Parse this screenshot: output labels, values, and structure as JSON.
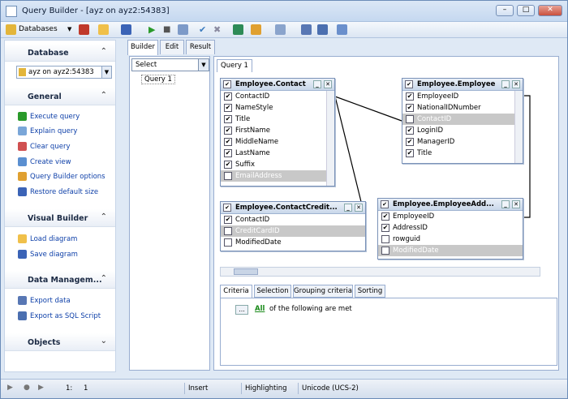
{
  "window": {
    "title": "Query Builder - [ayz on ayz2:54383]",
    "buttons": [
      "minimize",
      "maximize",
      "close"
    ]
  },
  "toolbar": {
    "database_label": "Databases"
  },
  "left": {
    "database": {
      "header": "Database",
      "selected": "ayz on ayz2:54383"
    },
    "general": {
      "header": "General",
      "items": [
        "Execute query",
        "Explain query",
        "Clear query",
        "Create view",
        "Query Builder options",
        "Restore default size"
      ]
    },
    "visual_builder": {
      "header": "Visual Builder",
      "items": [
        "Load diagram",
        "Save diagram"
      ]
    },
    "data_management": {
      "header": "Data Managem...",
      "items": [
        "Export data",
        "Export as SQL Script"
      ]
    },
    "objects": {
      "header": "Objects"
    }
  },
  "tabs": [
    "Builder",
    "Edit",
    "Result"
  ],
  "tree": {
    "select_value": "Select",
    "items": [
      "Query 1"
    ]
  },
  "query_tab": "Query 1",
  "tables": {
    "contact": {
      "title": "Employee.Contact",
      "fields": [
        "ContactID",
        "NameStyle",
        "Title",
        "FirstName",
        "MiddleName",
        "LastName",
        "Suffix",
        "EmailAddress"
      ]
    },
    "employee": {
      "title": "Employee.Employee",
      "fields": [
        "EmployeeID",
        "NationalIDNumber",
        "ContactID",
        "LoginID",
        "ManagerID",
        "Title"
      ]
    },
    "contact_credit": {
      "title": "Employee.ContactCredit...",
      "fields": [
        "ContactID",
        "CreditCardID",
        "ModifiedDate"
      ]
    },
    "employee_address": {
      "title": "Employee.EmployeeAdd...",
      "fields": [
        "EmployeeID",
        "AddressID",
        "rowguid",
        "ModifiedDate"
      ]
    }
  },
  "bottom_tabs": [
    "Criteria",
    "Selection",
    "Grouping criteria",
    "Sorting"
  ],
  "criteria": {
    "button": "...",
    "all_link": "All",
    "text": "of the following are met"
  },
  "status": {
    "position_label": "1:",
    "position_value": "1",
    "mode": "Insert",
    "highlighting": "Highlighting",
    "encoding": "Unicode (UCS-2)"
  },
  "colors": {
    "accent": "#0d3fa8",
    "header_bg": "#c9d7ea",
    "selected_row": "#c8c8c8"
  }
}
